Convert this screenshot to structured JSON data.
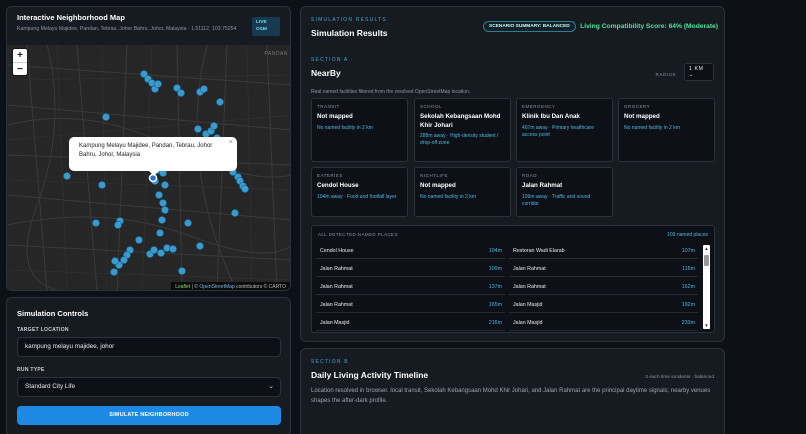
{
  "map": {
    "title": "Interactive Neighborhood Map",
    "location": "Kampung Melayu Majidee, Pandan, Tebrau, Johor Bahru, Johor, Malaysia · 1.51112, 103.75254",
    "badge": "LIVE OSM",
    "zoom_in": "+",
    "zoom_out": "−",
    "district_label": "PANDAN",
    "popup": "Kampung Melayu Majidee, Pandan, Tebrau, Johor Bahru, Johor, Malaysia",
    "popup_close": "×",
    "attr_leaflet": "Leaflet",
    "attr_sep": " | © ",
    "attr_osm": "OpenStreetMap",
    "attr_rest": " contributors © CARTO",
    "colors": {
      "marker": "#3ba7e0",
      "background": "#262626"
    }
  },
  "controls": {
    "title": "Simulation Controls",
    "target_label": "TARGET LOCATION",
    "target_value": "kampung melayu majidee, johor",
    "run_label": "RUN TYPE",
    "run_value": "Standard City Life",
    "button": "SIMULATE NEIGHBORHOOD"
  },
  "results": {
    "eyebrow": "SIMULATION RESULTS",
    "title": "Simulation Results",
    "scenario": "SCENARIO SUMMARY: BALANCED",
    "score": "Living Compatibility Score: 64% (Moderate)",
    "section_eyebrow": "SECTION A",
    "section_title": "NearBy",
    "radius_label": "RADIUS",
    "radius_value": "1 KM",
    "description": "Real named facilities filtered from the resolved OpenStreetMap location.",
    "cards": [
      {
        "label": "TRANSIT",
        "value": "Not mapped",
        "desc": "No named facility in 2 km"
      },
      {
        "label": "SCHOOL",
        "value": "Sekolah Kebangsaan Mohd Khir Johari",
        "desc": "288m away · High-density student / drop-off zone"
      },
      {
        "label": "EMERGENCY",
        "value": "Klinik Ibu Dan Anak",
        "desc": "407m away · Primary healthcare access point"
      },
      {
        "label": "GROCERY",
        "value": "Not mapped",
        "desc": "No named facility in 2 km"
      },
      {
        "label": "EATERIES",
        "value": "Cendol House",
        "desc": "104m away · Food and footfall layer"
      },
      {
        "label": "NIGHTLIFE",
        "value": "Not mapped",
        "desc": "No named facility in 2 km"
      },
      {
        "label": "ROAD",
        "value": "Jalan Rahmat",
        "desc": "109m away · Traffic and sound corridor"
      }
    ],
    "detected_title": "ALL DETECTED NAMED PLACES",
    "detected_count": "109 named places",
    "detected": [
      {
        "name": "Cendol House",
        "dist": "104m"
      },
      {
        "name": "Restoran Wadi Elarab",
        "dist": "107m"
      },
      {
        "name": "Jalan Rahmat",
        "dist": "109m"
      },
      {
        "name": "Jalan Rahmat",
        "dist": "116m"
      },
      {
        "name": "Jalan Rahmat",
        "dist": "137m"
      },
      {
        "name": "Jalan Rahmat",
        "dist": "162m"
      },
      {
        "name": "Jalan Rahmat",
        "dist": "165m"
      },
      {
        "name": "Jalan Masjid",
        "dist": "192m"
      },
      {
        "name": "Jalan Masjid",
        "dist": "216m"
      },
      {
        "name": "Jalan Masjid",
        "dist": "233m"
      }
    ]
  },
  "timeline": {
    "eyebrow": "SECTION B",
    "title": "Daily Living Activity Timeline",
    "pill": "3 each time incidents · balanced",
    "description": "Location resolved in browser. local transit, Sekolah Kebangsaan Mohd Khir Johari, and Jalan Rahmat are the principal daytime signals; nearby venues shapes the after-dark profile."
  }
}
